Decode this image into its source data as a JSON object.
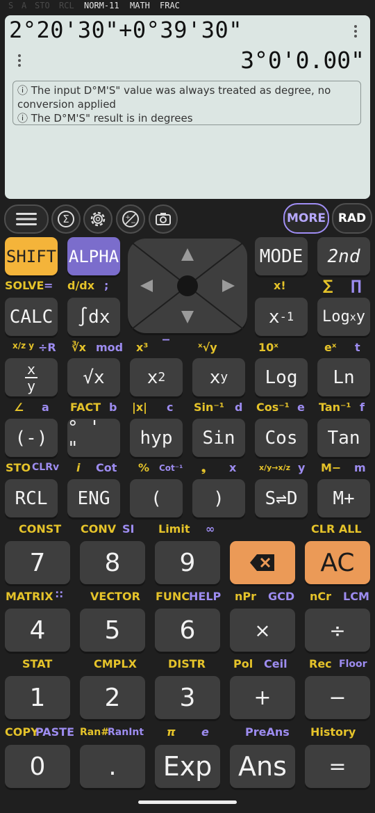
{
  "indicators": [
    {
      "label": "S",
      "active": false
    },
    {
      "label": "A",
      "active": false
    },
    {
      "label": "STO",
      "active": false
    },
    {
      "label": "RCL",
      "active": false
    },
    {
      "label": "NORM-11",
      "active": true
    },
    {
      "label": "MATH",
      "active": true
    },
    {
      "label": "FRAC",
      "active": true
    }
  ],
  "display": {
    "expression": "2°20'30\"+0°39'30\"",
    "result": "3°0'0.00\"",
    "notes": [
      "ⓘ The input D°M'S\" value was always treated as degree, no conversion applied",
      "ⓘ The D°M'S\" result is in degrees"
    ]
  },
  "toolbar": {
    "menu_icon": "menu-icon",
    "sum_icon": "sigma-icon",
    "settings_icon": "gear-icon",
    "plusminus_icon": "plus-minus-icon",
    "camera_icon": "camera-icon",
    "more_label": "MORE",
    "rad_label": "RAD"
  },
  "colors": {
    "shift": "#f4b43a",
    "alpha": "#7b6dcc",
    "orange": "#eb9a57",
    "display": "#dce6e3",
    "yellow_label": "#e5c32a",
    "purple_label": "#9d8cf0"
  },
  "keys": {
    "shift": "SHIFT",
    "alpha": "ALPHA",
    "mode": "MODE",
    "second": "2nd",
    "calc": "CALC",
    "integral": "∫dx",
    "inverse": "x",
    "inverse_exp": "-1",
    "log_base": "Log",
    "log_base_sub": "x",
    "log_base_y": "y",
    "fraction_num": "x",
    "fraction_den": "y",
    "sqrt": "√x",
    "square": "x",
    "square_exp": "2",
    "power": "x",
    "power_exp": "y",
    "log": "Log",
    "ln": "Ln",
    "negate": "(-)",
    "dms": "° ' \"",
    "hyp": "hyp",
    "sin": "Sin",
    "cos": "Cos",
    "tan": "Tan",
    "rcl": "RCL",
    "eng": "ENG",
    "lparen": "(",
    "rparen": ")",
    "sd": "S⇌D",
    "mplus": "M+",
    "seven": "7",
    "eight": "8",
    "nine": "9",
    "ac": "AC",
    "four": "4",
    "five": "5",
    "six": "6",
    "multiply": "×",
    "divide": "÷",
    "one": "1",
    "two": "2",
    "three": "3",
    "plus": "+",
    "minus": "−",
    "zero": "0",
    "dot": ".",
    "exp": "Exp",
    "ans": "Ans",
    "equals": "="
  },
  "labels": {
    "solve": "SOLVE",
    "solve_eq": "=",
    "ddx": "d/dx",
    "semicolon": ";",
    "factorial": "x!",
    "sigma": "∑",
    "pi_product": "∏",
    "frac_shift": "x/z y",
    "frac_alpha": "÷R",
    "cbrt": "∛x",
    "mod": "mod",
    "cube": "x³",
    "overline": "‾",
    "xroot": "ˣ√y",
    "ten_pow": "10ˣ",
    "e_pow": "eˣ",
    "t": "t",
    "angle": "∠",
    "a": "a",
    "fact": "FACT",
    "b": "b",
    "abs": "|x|",
    "c": "c",
    "asin": "Sin⁻¹",
    "d": "d",
    "acos": "Cos⁻¹",
    "e": "e",
    "atan": "Tan⁻¹",
    "f": "f",
    "sto": "STO",
    "clrv": "CLRv",
    "i": "i",
    "cot": "Cot",
    "percent": "%",
    "acot": "Cot⁻¹",
    "comma": "❟",
    "x": "x",
    "frac_conv": "x/y→x/z",
    "y": "y",
    "mminus": "M−",
    "m": "m",
    "const": "CONST",
    "conv": "CONV",
    "si": "SI",
    "limit": "Limit",
    "inf": "∞",
    "clr_all": "CLR ALL",
    "matrix": "MATRIX",
    "vector": "VECTOR",
    "func": "FUNC",
    "help": "HELP",
    "npr": "nPr",
    "gcd": "GCD",
    "ncr": "nCr",
    "lcm": "LCM",
    "stat": "STAT",
    "cmplx": "CMPLX",
    "distr": "DISTR",
    "pol": "Pol",
    "ceil": "Ceil",
    "rec": "Rec",
    "floor": "Floor",
    "copy": "COPY",
    "paste": "PASTE",
    "ran": "Ran#",
    "ranint": "RanInt",
    "pi": "π",
    "e_const": "e",
    "preans": "PreAns",
    "history": "History"
  }
}
